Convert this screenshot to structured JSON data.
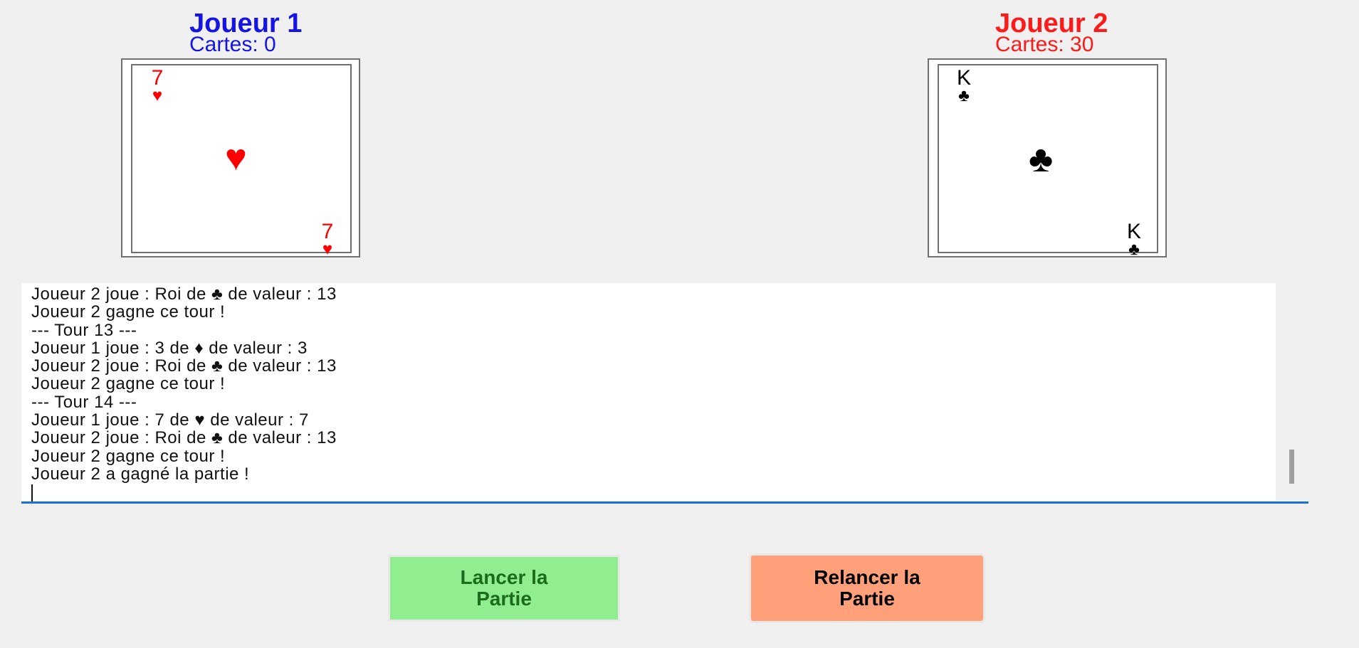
{
  "player1": {
    "name": "Joueur 1",
    "count": "Cartes: 0",
    "color": "#1414e6",
    "card": {
      "rank": "7",
      "suit": "♥",
      "suit_name": "heart-icon",
      "color": "#ff0000"
    }
  },
  "player2": {
    "name": "Joueur 2",
    "count": "Cartes: 30",
    "color": "#ff1a1a",
    "card": {
      "rank": "K",
      "suit": "♣",
      "suit_name": "club-icon",
      "color": "#000000"
    }
  },
  "log": {
    "lines": [
      "Joueur 2 joue : Roi de ♣ de valeur : 13",
      "Joueur 2 gagne ce tour !",
      "--- Tour 13 ---",
      "Joueur 1 joue : 3 de ♦ de valeur : 3",
      "Joueur 2 joue : Roi de ♣ de valeur : 13",
      "Joueur 2 gagne ce tour !",
      "--- Tour 14 ---",
      "Joueur 1 joue : 7 de ♥ de valeur : 7",
      "Joueur 2 joue : Roi de ♣ de valeur : 13",
      "Joueur 2 gagne ce tour !",
      "Joueur 2 a gagné la partie !"
    ]
  },
  "buttons": {
    "start": {
      "label_line1": "Lancer la",
      "label_line2": "Partie",
      "bg": "#90ee90",
      "fg": "#1a6b1a"
    },
    "restart": {
      "label_line1": "Relancer la",
      "label_line2": "Partie",
      "bg": "#ffa07a",
      "fg": "#000000"
    }
  }
}
